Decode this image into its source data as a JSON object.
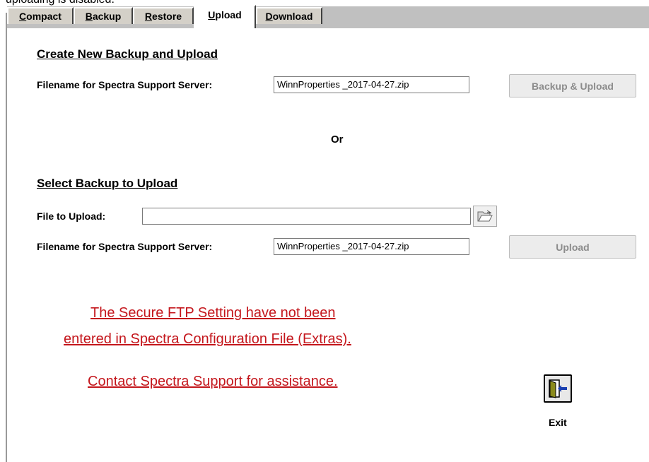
{
  "caption": "uploading is disabled.",
  "tabs": [
    {
      "pre": "",
      "key": "C",
      "rest": "ompact"
    },
    {
      "pre": "",
      "key": "B",
      "rest": "ackup"
    },
    {
      "pre": "",
      "key": "R",
      "rest": "estore"
    },
    {
      "pre": "",
      "key": "U",
      "rest": "pload"
    },
    {
      "pre": "",
      "key": "D",
      "rest": "ownload"
    }
  ],
  "active_tab": "Upload",
  "create_section": {
    "title": "Create New Backup and Upload",
    "filename_label": "Filename for Spectra Support Server:",
    "filename_value": "WinnProperties _2017-04-27.zip",
    "button": "Backup & Upload"
  },
  "or_text": "Or",
  "select_section": {
    "title": "Select Backup to Upload",
    "file_label": "File to Upload:",
    "file_value": "",
    "filename_label": "Filename for Spectra Support Server:",
    "filename_value": "WinnProperties _2017-04-27.zip",
    "button": "Upload"
  },
  "warning": {
    "line1": "The Secure FTP Setting have not been",
    "line2": "entered in Spectra Configuration File (Extras).",
    "line3": "Contact Spectra Support for assistance."
  },
  "exit": {
    "label": "Exit",
    "icon": "exit-door-icon"
  },
  "colors": {
    "warning": "#c4161c",
    "tab_strip": "#c0c0c0",
    "tab": "#d4d0c8",
    "exit_arrow": "#1a3fb0",
    "door": "#8a8a1a"
  }
}
